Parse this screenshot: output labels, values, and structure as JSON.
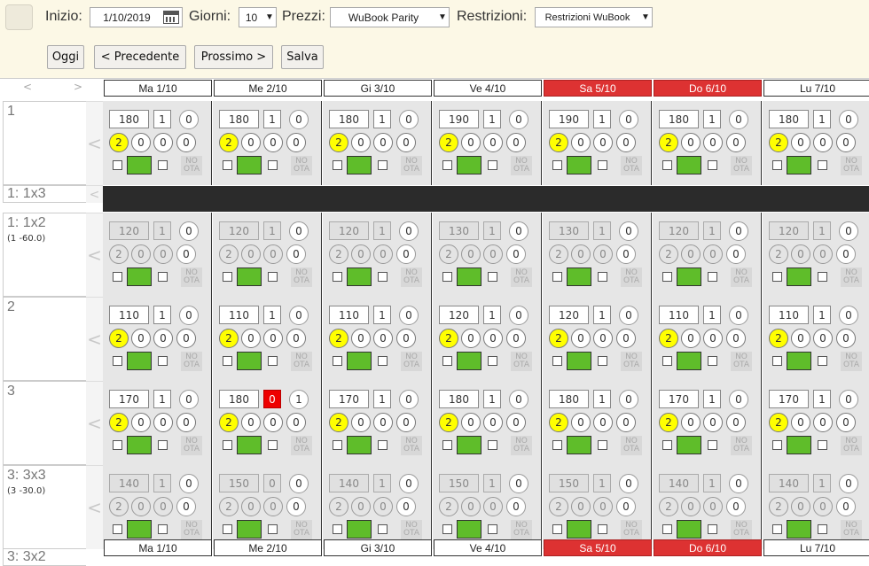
{
  "toolbar": {
    "start_label": "Inizio:",
    "start_value": "1/10/2019",
    "days_label": "Giorni:",
    "days_value": "10",
    "prices_label": "Prezzi:",
    "prices_value": "WuBook Parity",
    "restrictions_label": "Restrizioni:",
    "restrictions_value": "Restrizioni WuBook",
    "today_label": "Oggi",
    "prev_label": "< Precedente",
    "next_label": "Prossimo >",
    "save_label": "Salva"
  },
  "nav": {
    "left": "<",
    "right": ">"
  },
  "days": [
    {
      "label": "Ma 1/10",
      "weekend": false
    },
    {
      "label": "Me 2/10",
      "weekend": false
    },
    {
      "label": "Gi 3/10",
      "weekend": false
    },
    {
      "label": "Ve 4/10",
      "weekend": false
    },
    {
      "label": "Sa 5/10",
      "weekend": true
    },
    {
      "label": "Do 6/10",
      "weekend": true
    },
    {
      "label": "Lu 7/10",
      "weekend": false
    }
  ],
  "rows": [
    {
      "title": "1",
      "sub": "",
      "readonly": false,
      "cells": [
        {
          "price": "180",
          "avail": "1",
          "booked": "0",
          "closed": false
        },
        {
          "price": "180",
          "avail": "1",
          "booked": "0",
          "closed": false
        },
        {
          "price": "180",
          "avail": "1",
          "booked": "0",
          "closed": false
        },
        {
          "price": "190",
          "avail": "1",
          "booked": "0",
          "closed": false
        },
        {
          "price": "190",
          "avail": "1",
          "booked": "0",
          "closed": false
        },
        {
          "price": "180",
          "avail": "1",
          "booked": "0",
          "closed": false
        },
        {
          "price": "180",
          "avail": "1",
          "booked": "0",
          "closed": false
        }
      ]
    },
    {
      "title": "1: 1x2",
      "sub": "(1 -60.0)",
      "readonly": true,
      "cells": [
        {
          "price": "120",
          "avail": "1",
          "booked": "0",
          "closed": false
        },
        {
          "price": "120",
          "avail": "1",
          "booked": "0",
          "closed": false
        },
        {
          "price": "120",
          "avail": "1",
          "booked": "0",
          "closed": false
        },
        {
          "price": "130",
          "avail": "1",
          "booked": "0",
          "closed": false
        },
        {
          "price": "130",
          "avail": "1",
          "booked": "0",
          "closed": false
        },
        {
          "price": "120",
          "avail": "1",
          "booked": "0",
          "closed": false
        },
        {
          "price": "120",
          "avail": "1",
          "booked": "0",
          "closed": false
        }
      ]
    },
    {
      "title": "2",
      "sub": "",
      "readonly": false,
      "cells": [
        {
          "price": "110",
          "avail": "1",
          "booked": "0",
          "closed": false
        },
        {
          "price": "110",
          "avail": "1",
          "booked": "0",
          "closed": false
        },
        {
          "price": "110",
          "avail": "1",
          "booked": "0",
          "closed": false
        },
        {
          "price": "120",
          "avail": "1",
          "booked": "0",
          "closed": false
        },
        {
          "price": "120",
          "avail": "1",
          "booked": "0",
          "closed": false
        },
        {
          "price": "110",
          "avail": "1",
          "booked": "0",
          "closed": false
        },
        {
          "price": "110",
          "avail": "1",
          "booked": "0",
          "closed": false
        }
      ]
    },
    {
      "title": "3",
      "sub": "",
      "readonly": false,
      "cells": [
        {
          "price": "170",
          "avail": "1",
          "booked": "0",
          "closed": false
        },
        {
          "price": "180",
          "avail": "0",
          "booked": "1",
          "closed": true
        },
        {
          "price": "170",
          "avail": "1",
          "booked": "0",
          "closed": false
        },
        {
          "price": "180",
          "avail": "1",
          "booked": "0",
          "closed": false
        },
        {
          "price": "180",
          "avail": "1",
          "booked": "0",
          "closed": false
        },
        {
          "price": "170",
          "avail": "1",
          "booked": "0",
          "closed": false
        },
        {
          "price": "170",
          "avail": "1",
          "booked": "0",
          "closed": false
        }
      ]
    },
    {
      "title": "3: 3x3",
      "sub": "(3 -30.0)",
      "readonly": true,
      "cells": [
        {
          "price": "140",
          "avail": "1",
          "booked": "0",
          "closed": false
        },
        {
          "price": "150",
          "avail": "0",
          "booked": "0",
          "closed": true
        },
        {
          "price": "140",
          "avail": "1",
          "booked": "0",
          "closed": false
        },
        {
          "price": "150",
          "avail": "1",
          "booked": "0",
          "closed": false
        },
        {
          "price": "150",
          "avail": "1",
          "booked": "0",
          "closed": false
        },
        {
          "price": "140",
          "avail": "1",
          "booked": "0",
          "closed": false
        },
        {
          "price": "140",
          "avail": "1",
          "booked": "0",
          "closed": false
        }
      ]
    }
  ],
  "cell_common": {
    "min_stay": "2",
    "r1": "0",
    "r2": "0",
    "r3": "0",
    "no": "NO",
    "ota": "OTA"
  },
  "collapsed_row": "1: 1x3",
  "bottom_row": "3: 3x2",
  "arrow": "<",
  "colors": {
    "weekend": "#dd3232",
    "closed_avail": "#ee0000",
    "open_status": "#5fbd2a",
    "min_stay": "#ffff00"
  }
}
